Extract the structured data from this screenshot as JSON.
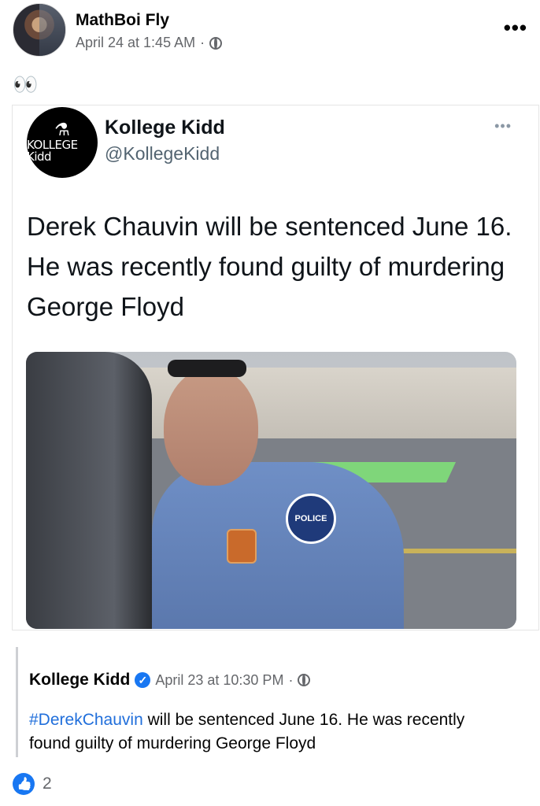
{
  "post": {
    "author": "MathBoi Fly",
    "timestamp": "April 24 at 1:45 AM",
    "separator": "·",
    "audience_icon": "globe-icon",
    "more_label": "•••",
    "text": "👀"
  },
  "tweet": {
    "avatar_text": "KOLLEGE Kidd",
    "avatar_symbol": "⚗",
    "name": "Kollege Kidd",
    "handle": "@KollegeKidd",
    "more_label": "•••",
    "text": "Derek Chauvin will be sentenced June 16. He was recently found guilty of murdering George Floyd",
    "photo_patch_text": "POLICE"
  },
  "shared_post": {
    "name": "Kollege Kidd",
    "verified_icon": "verified-badge-icon",
    "verified_glyph": "✓",
    "timestamp": "April 23 at 10:30 PM",
    "separator": "·",
    "hashtag": "#DerekChauvin",
    "text_rest": " will be sentenced June 16. He was recently found guilty of murdering George Floyd"
  },
  "reactions": {
    "icon": "like-icon",
    "count": "2"
  },
  "colors": {
    "facebook_blue": "#1877f2",
    "hashtag_blue": "#216fdb",
    "meta_gray": "#65676b"
  }
}
